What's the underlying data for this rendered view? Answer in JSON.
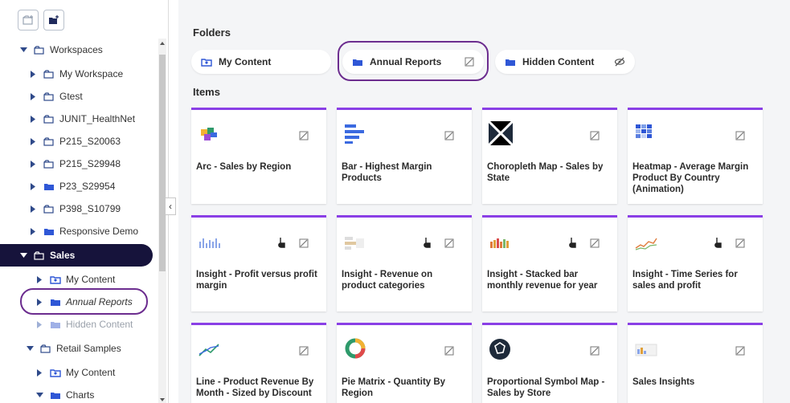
{
  "sidebar": {
    "tree": [
      {
        "label": "Workspaces",
        "icon": "workspace-icon",
        "expanded": true
      },
      {
        "label": "My Workspace",
        "icon": "workspace-icon"
      },
      {
        "label": "Gtest",
        "icon": "workspace-icon"
      },
      {
        "label": "JUNIT_HealthNet",
        "icon": "workspace-icon"
      },
      {
        "label": "P215_S20063",
        "icon": "workspace-icon"
      },
      {
        "label": "P215_S29948",
        "icon": "workspace-icon"
      },
      {
        "label": "P23_S29954",
        "icon": "folder-icon"
      },
      {
        "label": "P398_S10799",
        "icon": "workspace-icon"
      },
      {
        "label": "Responsive Demo",
        "icon": "folder-icon"
      },
      {
        "label": "Sales",
        "icon": "workspace-icon",
        "selected": true
      },
      {
        "label": "My Content",
        "icon": "my-content-icon"
      },
      {
        "label": "Annual Reports",
        "icon": "folder-icon"
      },
      {
        "label": "Hidden Content",
        "icon": "folder-icon"
      },
      {
        "label": "Retail Samples",
        "icon": "workspace-icon"
      },
      {
        "label": "My Content",
        "icon": "my-content-icon"
      },
      {
        "label": "Charts",
        "icon": "folder-icon"
      }
    ]
  },
  "main": {
    "folders_title": "Folders",
    "items_title": "Items",
    "folders": [
      {
        "label": "My Content"
      },
      {
        "label": "Annual Reports"
      },
      {
        "label": "Hidden Content"
      }
    ],
    "items": [
      {
        "title": "Arc - Sales by Region",
        "thumb": "arc-puzzle-icon"
      },
      {
        "title": "Bar - Highest Margin Products",
        "thumb": "bar-chart-icon"
      },
      {
        "title": "Choropleth Map - Sales by State",
        "thumb": "choropleth-icon"
      },
      {
        "title": "Heatmap - Average Margin Product By Country (Animation)",
        "thumb": "heatmap-icon"
      },
      {
        "title": "Insight - Profit versus profit margin",
        "thumb": "insight-icon"
      },
      {
        "title": "Insight - Revenue on product categories",
        "thumb": "insight-icon"
      },
      {
        "title": "Insight - Stacked bar monthly revenue for year",
        "thumb": "insight-icon"
      },
      {
        "title": "Insight - Time Series for sales and profit",
        "thumb": "insight-icon"
      },
      {
        "title": "Line - Product Revenue By Month - Sized by Discount",
        "thumb": "line-chart-icon"
      },
      {
        "title": "Pie Matrix - Quantity By Region",
        "thumb": "pie-icon"
      },
      {
        "title": "Proportional Symbol Map - Sales by Store",
        "thumb": "symbol-map-icon"
      },
      {
        "title": "Sales Insights",
        "thumb": "insight-icon"
      }
    ]
  },
  "colors": {
    "accent": "#8a3fe6",
    "selected_bg": "#16133b",
    "highlight_ring": "#6c2d8f",
    "folder_blue": "#2f57d6"
  }
}
